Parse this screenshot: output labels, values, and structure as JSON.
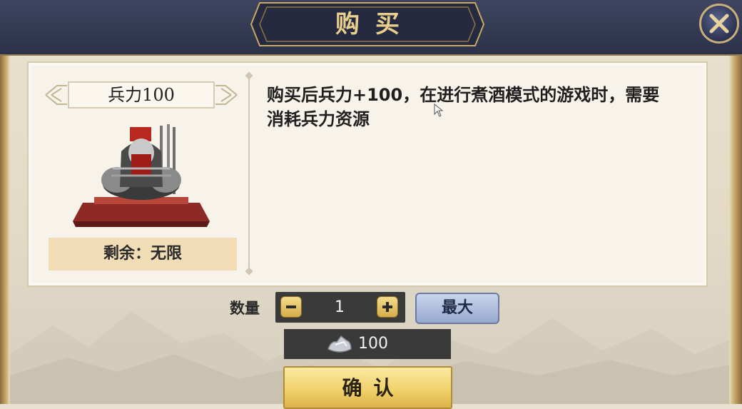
{
  "header": {
    "title": "购买"
  },
  "item": {
    "name": "兵力100",
    "remaining": "剩余：无限",
    "description": "购买后兵力+100，在进行煮酒模式的游戏时，需要消耗兵力资源"
  },
  "quantity": {
    "label": "数量",
    "value": "1",
    "max_label": "最大"
  },
  "cost": {
    "value": "100",
    "currency_icon": "silver-ingot-icon"
  },
  "confirm_label": "确认",
  "colors": {
    "header_bg": "#2c3149",
    "title_gold": "#e9cf8c",
    "confirm_gold": "#efcf67",
    "max_blue": "#98a9cf"
  }
}
